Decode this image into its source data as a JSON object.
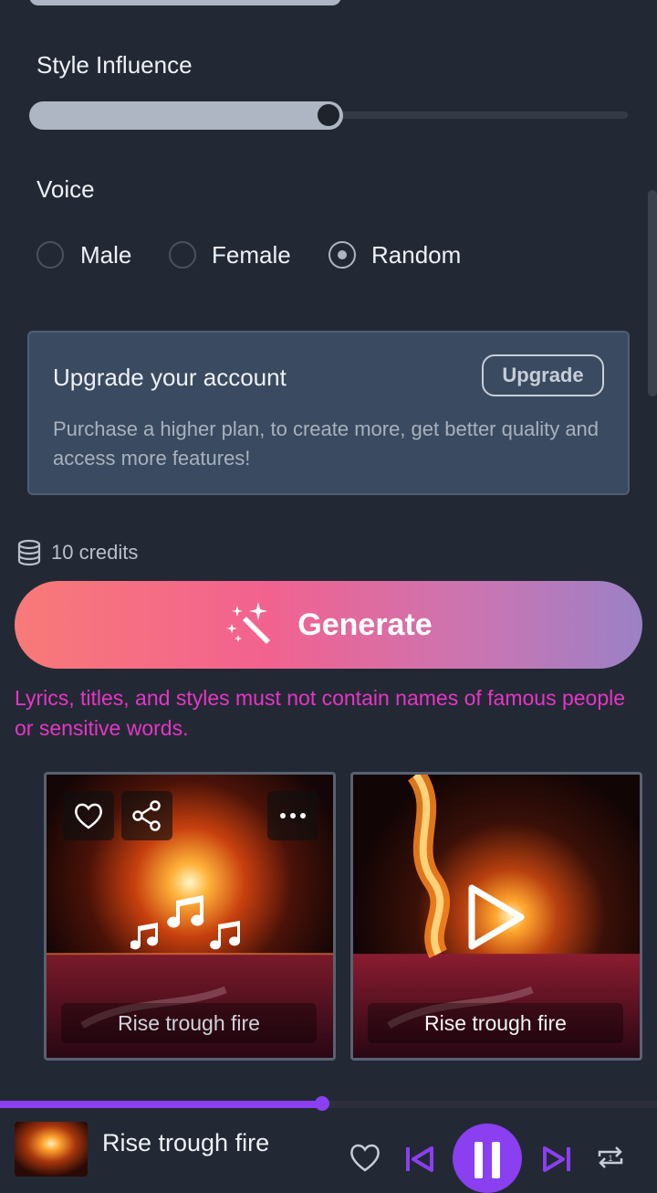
{
  "style_influence": {
    "label": "Style Influence",
    "value_fraction": 0.5
  },
  "voice": {
    "label": "Voice",
    "options": [
      "Male",
      "Female",
      "Random"
    ],
    "selected": "Random"
  },
  "upgrade": {
    "title": "Upgrade your account",
    "button": "Upgrade",
    "description": "Purchase a higher plan, to create more, get better quality and access more features!"
  },
  "credits": {
    "text": "10 credits",
    "icon": "database-icon"
  },
  "generate": {
    "label": "Generate",
    "icon": "magic-wand-icon"
  },
  "warning": "Lyrics, titles, and styles must not contain names of famous people or sensitive words.",
  "songs": [
    {
      "title": "Rise trough fire",
      "state": "playing"
    },
    {
      "title": "Rise trough fire",
      "state": "paused"
    }
  ],
  "player": {
    "title": "Rise trough fire",
    "progress_fraction": 0.49,
    "accent": "#8a3ff0"
  },
  "colors": {
    "warning": "#e635c5",
    "accent": "#8a3ff0",
    "background": "#232934"
  }
}
